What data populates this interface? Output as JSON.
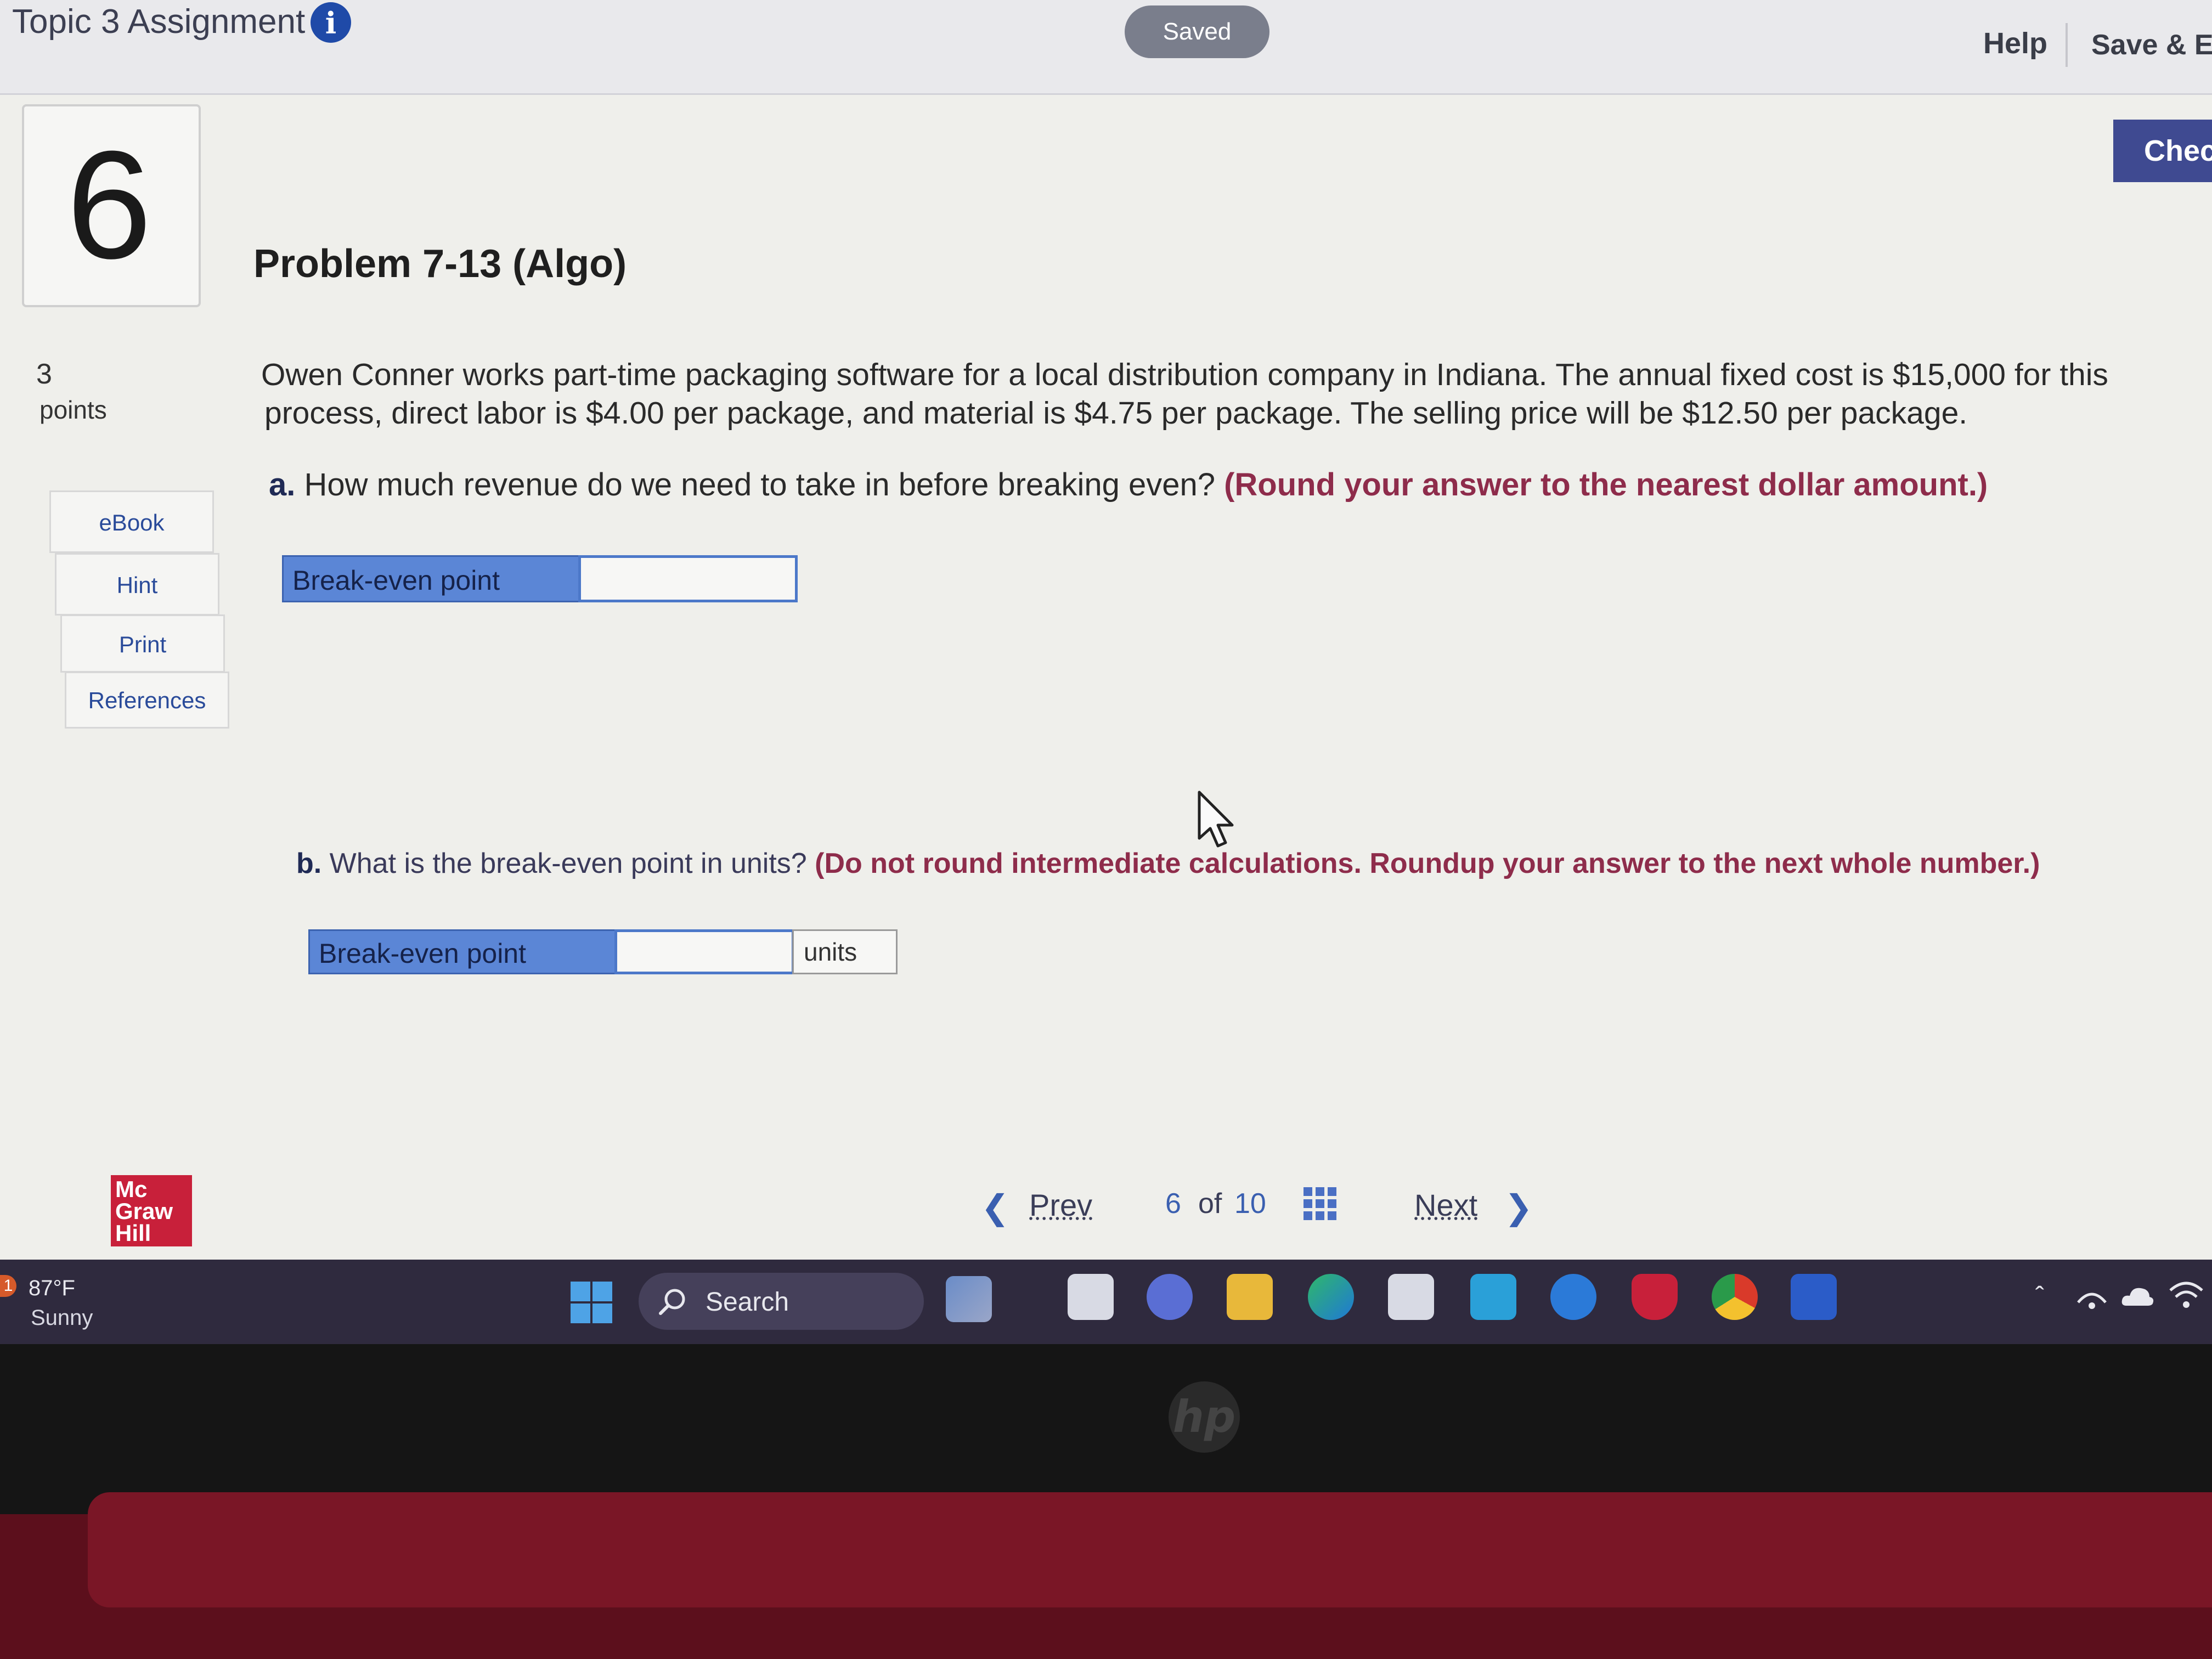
{
  "header": {
    "assignment_title": "Topic 3 Assignment",
    "status_pill": "Saved",
    "help_label": "Help",
    "save_exit_label": "Save & Ex",
    "check_label": "Chec"
  },
  "question": {
    "number": "6",
    "points_value": "3",
    "points_label": "points",
    "title": "Problem 7-13 (Algo)",
    "text_line1": "Owen Conner works part-time packaging software for a local distribution company in Indiana. The annual fixed cost is $15,000 for this",
    "text_line2": "process, direct labor is $4.00 per package, and material is $4.75 per package. The selling price will be $12.50 per package.",
    "part_a": {
      "label": "a.",
      "prompt": " How much revenue do we need to take in before breaking even? ",
      "instruction": "(Round your answer to the nearest dollar amount.)",
      "answer_label": "Break-even point",
      "answer_value": ""
    },
    "part_b": {
      "label": "b.",
      "prompt": " What is the break-even point in units? ",
      "instruction": "(Do not round intermediate calculations. Roundup your answer to the next whole number.)",
      "answer_label": "Break-even point",
      "answer_value": "",
      "unit": "units"
    }
  },
  "tools": {
    "ebook": "eBook",
    "hint": "Hint",
    "print": "Print",
    "references": "References"
  },
  "footer": {
    "brand_lines": [
      "Mc",
      "Graw",
      "Hill"
    ],
    "prev_label": "Prev",
    "current_page": "6",
    "of_label": "of",
    "total_pages": "10",
    "next_label": "Next"
  },
  "taskbar": {
    "weather_badge": "1",
    "temperature": "87°F",
    "condition": "Sunny",
    "search_label": "Search",
    "apps": [
      "copilot-icon",
      "file-explorer-icon",
      "teams-icon",
      "folder-icon",
      "edge-icon",
      "store-icon",
      "myhp-icon",
      "help-icon",
      "mcafee-icon",
      "chrome-icon",
      "word-icon"
    ]
  },
  "device": {
    "logo_text": "hp"
  },
  "colors": {
    "accent_blue": "#1f4aa8",
    "answer_blue": "#5b86d6",
    "instruction_red": "#8e2c4b",
    "check_button": "#3f4a91",
    "brand_red": "#c8203a"
  }
}
